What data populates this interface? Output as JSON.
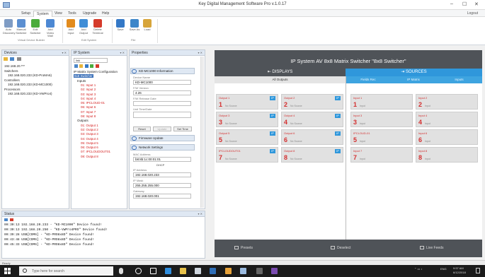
{
  "window": {
    "title": "Key Digital Management Software Pro v.1.0.17",
    "controls": [
      "–",
      "☐",
      "✕"
    ]
  },
  "menu": {
    "tabs": [
      "Setup",
      "System",
      "View",
      "Tools",
      "Upgrade",
      "Help"
    ],
    "active_index": 1,
    "login": "Logout"
  },
  "ribbon": {
    "buttons": [
      {
        "label": "Auto Discovery",
        "icon": "discover-icon",
        "color": "#7f9cc4"
      },
      {
        "label": "Manual Switcher",
        "icon": "manual-switcher-icon",
        "color": "#5b8fd1"
      },
      {
        "label": "Edit Switcher",
        "icon": "edit-switcher-icon",
        "color": "#4bab3c"
      },
      {
        "label": "Add Video Wall",
        "icon": "video-wall-icon",
        "color": "#4c88d3"
      },
      {
        "label": "Add Input",
        "icon": "add-input-icon",
        "color": "#e28b1d"
      },
      {
        "label": "Add Output",
        "icon": "add-output-icon",
        "color": "#3f8dd6"
      },
      {
        "label": "Delete Terminal",
        "icon": "delete-icon",
        "color": "#d53b2b"
      },
      {
        "label": "Save",
        "icon": "save-icon",
        "color": "#3478c6"
      },
      {
        "label": "Save As",
        "icon": "save-as-icon",
        "color": "#3c86c9"
      },
      {
        "label": "Load",
        "icon": "load-icon",
        "color": "#d7a53a"
      }
    ],
    "groups": [
      "Virtual Device Builder",
      "Edit System",
      "File"
    ]
  },
  "devices_pane": {
    "title": "Devices",
    "items": [
      {
        "text": "192.168.20.***",
        "indent": 1
      },
      {
        "text": "Switchers",
        "indent": 1
      },
      {
        "text": "192.168.020.233 (KD-ProMA6)",
        "indent": 2
      },
      {
        "text": "Controllers",
        "indent": 1
      },
      {
        "text": "192.168.020.233 (KD-MC1000)",
        "indent": 2
      },
      {
        "text": "Processors",
        "indent": 1
      },
      {
        "text": "192.168.020.233 (KD-VWPro4)",
        "indent": 2
      }
    ]
  },
  "ip_system_pane": {
    "title": "IP System",
    "combo": "link",
    "items": [
      {
        "text": "IP Matrix System Configuration",
        "indent": 1,
        "red": false
      },
      {
        "text": "8x8 Switcher",
        "indent": 1,
        "red": false,
        "selected": true
      },
      {
        "text": "Inputs",
        "indent": 2,
        "red": false
      },
      {
        "text": "01: Input 1",
        "indent": 3,
        "red": true
      },
      {
        "text": "02: Input 2",
        "indent": 3,
        "red": true
      },
      {
        "text": "03: Input 3",
        "indent": 3,
        "red": true
      },
      {
        "text": "04: Input 4",
        "indent": 3,
        "red": true
      },
      {
        "text": "05: IPCLOUD-01",
        "indent": 3,
        "red": true
      },
      {
        "text": "06: Input 6",
        "indent": 3,
        "red": true
      },
      {
        "text": "07: Input 7",
        "indent": 3,
        "red": true
      },
      {
        "text": "08: Input 8",
        "indent": 3,
        "red": true
      },
      {
        "text": "Outputs",
        "indent": 2,
        "red": false
      },
      {
        "text": "01: Output 1",
        "indent": 3,
        "red": true
      },
      {
        "text": "02: Output 2",
        "indent": 3,
        "red": true
      },
      {
        "text": "03: Output 3",
        "indent": 3,
        "red": true
      },
      {
        "text": "04: Output 4",
        "indent": 3,
        "red": true
      },
      {
        "text": "05: Output 5",
        "indent": 3,
        "red": true
      },
      {
        "text": "06: Output 6",
        "indent": 3,
        "red": true
      },
      {
        "text": "07: IPCLOUDOUT01",
        "indent": 3,
        "red": true
      },
      {
        "text": "08: Output 8",
        "indent": 3,
        "red": true
      }
    ]
  },
  "properties_pane": {
    "title": "Properties",
    "section_info": "KD-MC1000 Information",
    "device_name_label": "Device Name",
    "device_name": "KD-MC1000",
    "fw_version_label": "F/W Version",
    "fw_version": "4.26",
    "fw_release_label": "F/W Release Date",
    "fw_release": "",
    "time_label": "Unit Time/Date",
    "time_value": "",
    "reset_btn": "Reset",
    "update_btn": "Update",
    "set_time_btn": "Set Time",
    "section_firmware": "Firmware Update",
    "section_network": "Network Settings",
    "mac_label": "MAC Address",
    "mac_value": "b8:8b:1c:00:01:01",
    "dhcp_label": "DHCP",
    "ip_label": "IP Address",
    "ip_value": "192.168.020.233",
    "mask_label": "IP Mask",
    "mask_value": "255.255.255.000",
    "gateway_label": "Gateway",
    "gateway_value": "192.168.020.001"
  },
  "main": {
    "title": "IP System AV 8x8 Matrix Switcher \"8x8 Switcher\"",
    "tab_displays": "DISPLAYS",
    "tab_sources": "SOURCES",
    "subtab_all": "All Outputs",
    "source_subtabs": [
      "Fields Rec",
      "IP Matrix",
      "Inputs"
    ],
    "outputs": [
      {
        "label": "Output 1",
        "num": "1",
        "src": "No Source"
      },
      {
        "label": "Output 2",
        "num": "2",
        "src": "No Source"
      },
      {
        "label": "Output 3",
        "num": "3",
        "src": "No Source"
      },
      {
        "label": "Output 4",
        "num": "4",
        "src": "No Source"
      },
      {
        "label": "Output 5",
        "num": "5",
        "src": "No Source"
      },
      {
        "label": "Output 6",
        "num": "6",
        "src": "No Source"
      },
      {
        "label": "IPCLOUDOUT01",
        "num": "7",
        "src": "No Source"
      },
      {
        "label": "Output 8",
        "num": "8",
        "src": "No Source"
      }
    ],
    "output_badge": "IP",
    "inputs": [
      {
        "label": "Input 1",
        "num": "1",
        "src": "Input"
      },
      {
        "label": "Input 2",
        "num": "2",
        "src": "Input"
      },
      {
        "label": "Input 3",
        "num": "3",
        "src": "Input"
      },
      {
        "label": "Input 4",
        "num": "4",
        "src": "Input"
      },
      {
        "label": "IPCLOUD-01",
        "num": "5",
        "src": "Input"
      },
      {
        "label": "Input 6",
        "num": "6",
        "src": "Input"
      },
      {
        "label": "Input 7",
        "num": "7",
        "src": "Input"
      },
      {
        "label": "Input 8",
        "num": "8",
        "src": "Input"
      }
    ],
    "footer_presets": "Presets",
    "footer_deselect": "Deselect",
    "footer_live": "Live Feeds"
  },
  "status_pane": {
    "title": "Status",
    "lines": [
      "09:30:13   192.168.20.233 - \"KD-MC1000\" Device found!",
      "09:30:13   192.168.20.250 - \"KD-VWPro4PRO\" Device found!",
      "09:39:28   USB[COM6] - \"KD-PRO8x8D\" Device found!",
      "09:43:48   USB[COM6] - \"KD-PRO8x8D\" Device found!",
      "09:45:33   USB[COM6] - \"KD-PRO8x8D\" Device found!"
    ]
  },
  "statusbar": {
    "text": "Ready"
  },
  "taskbar": {
    "search_placeholder": "Type here for search",
    "clock_time": "9:57 AM",
    "clock_date": "6/12/2018",
    "lang": "ENG"
  }
}
